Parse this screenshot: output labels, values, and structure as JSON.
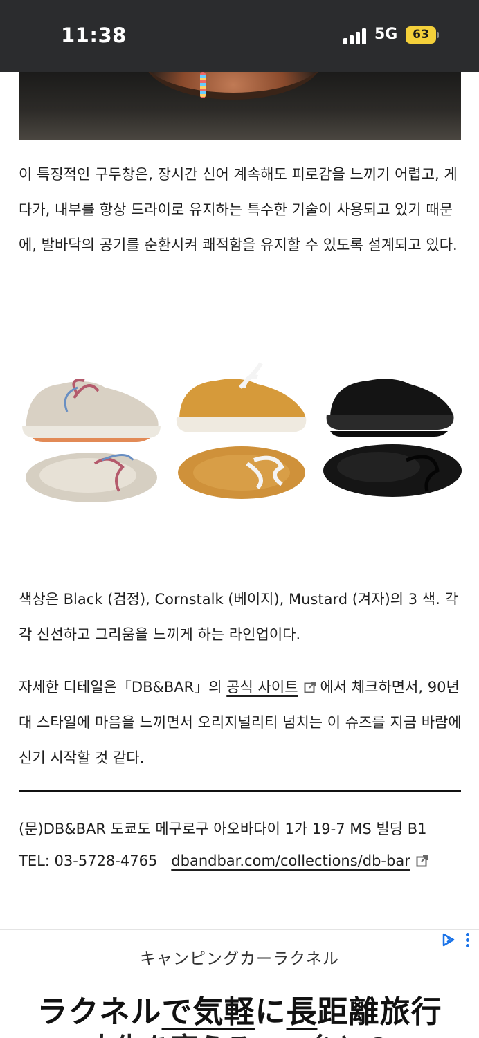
{
  "status_bar": {
    "time": "11:38",
    "network": "5G",
    "battery": "63",
    "battery_color": "#f4d03a"
  },
  "article": {
    "paragraph1": "이 특징적인 구두창은, 장시간 신어 계속해도 피로감을 느끼기 어렵고, 게다가, 내부를 항상 드라이로 유지하는 특수한 기술이 사용되고 있기 때문에, 발바닥의 공기를 순환시켜 쾌적함을 유지할 수 있도록 설계되고 있다.",
    "paragraph2": "색상은 Black (검정), Cornstalk (베이지), Mustard (겨자)의 3 색. 각각 신선하고 그리움을 느끼게 하는 라인업이다.",
    "paragraph3_before": "자세한 디테일은「DB&BAR」의 ",
    "paragraph3_link": "공식 사이트",
    "paragraph3_after": "에서 체크하면서, 90년대 스타일에 마음을 느끼면서 오리지널리티 넘치는 이 슈즈를 지금 바람에 신기 시작할 것 같다.",
    "shoe_colors": [
      "Cornstalk",
      "Mustard",
      "Black"
    ]
  },
  "contact": {
    "address": "(문)DB&BAR 도쿄도 메구로구 아오바다이 1가 19-7 MS 빌딩 B1",
    "tel": "TEL: 03-5728-4765",
    "website": "dbandbar.com/collections/db-bar"
  },
  "ad": {
    "brand": "キャンピングカーラクネル",
    "headline_1": "ラクネル",
    "headline_2": "で気軽",
    "headline_3": "に",
    "headline_4": "長",
    "headline_5": "距離旅行",
    "subline": "人生を変える　　台との"
  }
}
